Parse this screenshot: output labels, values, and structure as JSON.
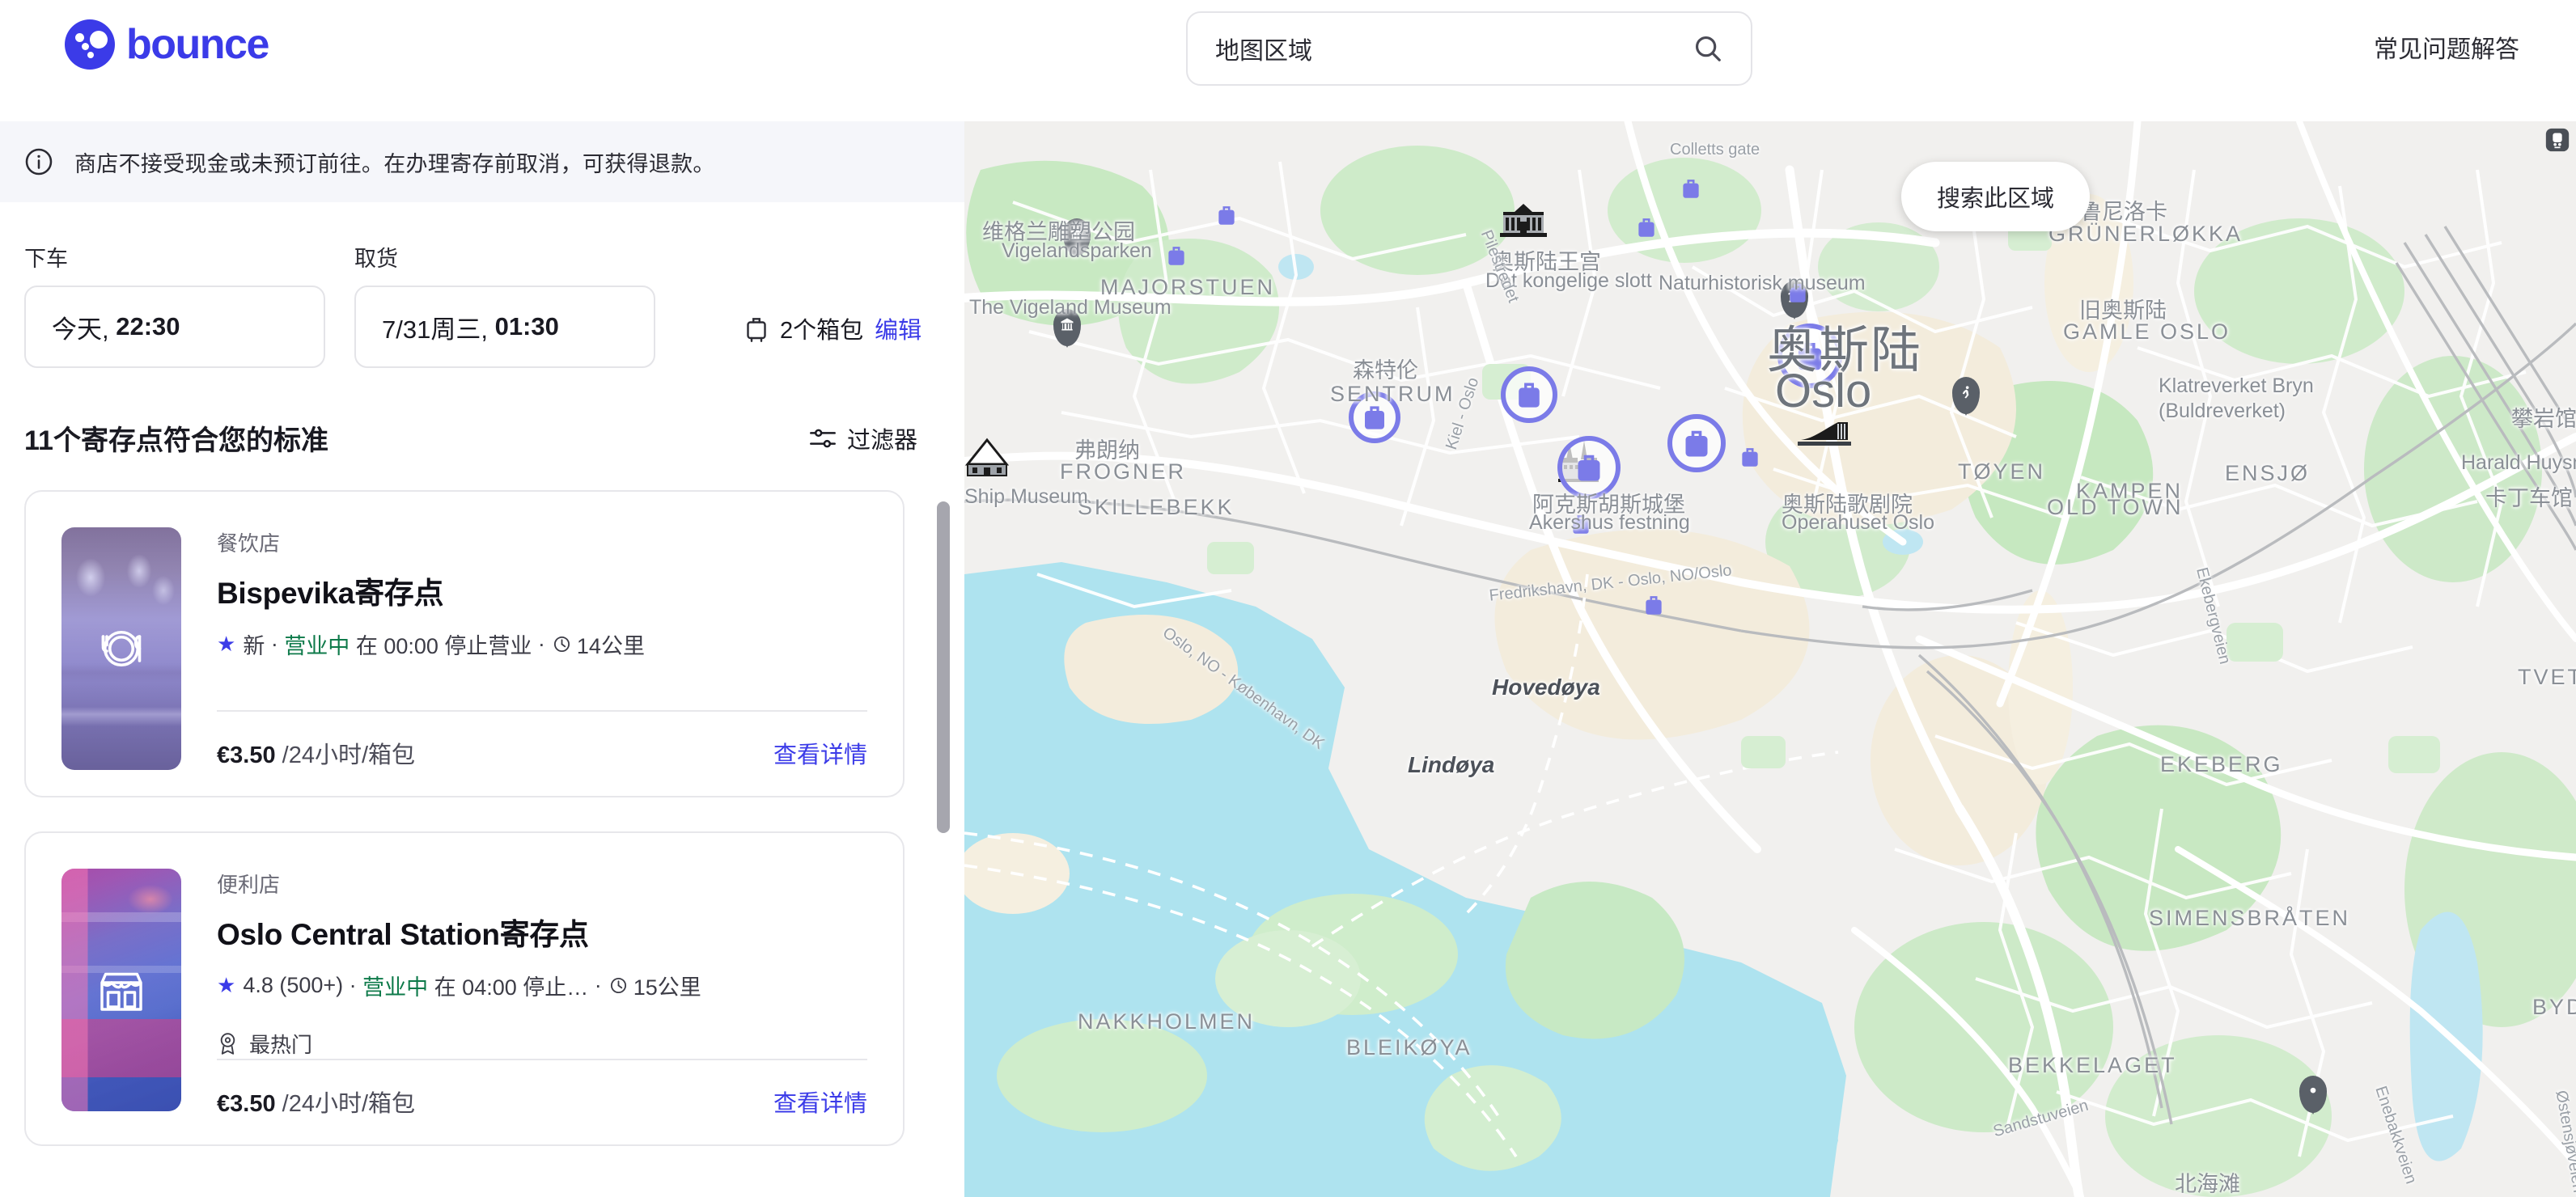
{
  "header": {
    "brand": "bounce",
    "search": {
      "value": "地图区域",
      "placeholder": "地图区域",
      "icon": "search-icon"
    },
    "faq_label": "常见问题解答"
  },
  "banner": {
    "icon": "info-icon",
    "text": "商店不接受现金或未预订前往。在办理寄存前取消，可获得退款。"
  },
  "booking": {
    "dropoff": {
      "label": "下车",
      "day": "今天,",
      "time": "22:30"
    },
    "pickup": {
      "label": "取货",
      "day": "7/31周三,",
      "time": "01:30"
    },
    "bags": {
      "icon": "luggage-icon",
      "count_label": "2个箱包",
      "edit_label": "编辑"
    }
  },
  "results": {
    "title": "11个寄存点符合您的标准",
    "filter": {
      "icon": "filter-icon",
      "label": "过滤器"
    },
    "cards": [
      {
        "thumb_class": "restaurant",
        "thumb_icon": "restaurant-icon",
        "category": "餐饮店",
        "title": "Bispevika寄存点",
        "rating": "新",
        "status": "营业中",
        "hours": "在 00:00 停止营业",
        "distance": "14公里",
        "badge": null,
        "price_amount": "€3.50",
        "price_unit": "/24小时/箱包",
        "details_label": "查看详情"
      },
      {
        "thumb_class": "convenience",
        "thumb_icon": "store-icon",
        "category": "便利店",
        "title": "Oslo Central Station寄存点",
        "rating": "4.8 (500+)",
        "status": "营业中",
        "hours": "在 04:00 停止…",
        "distance": "15公里",
        "badge": {
          "icon": "award-icon",
          "label": "最热门"
        },
        "price_amount": "€3.50",
        "price_unit": "/24小时/箱包",
        "details_label": "查看详情"
      }
    ]
  },
  "map": {
    "search_area_label": "搜索此区域",
    "corner_icon": "train-station-icon",
    "marker_color": "#7B7BE8",
    "city_label_cn": "奥斯陆",
    "city_label_en": "Oslo",
    "labels": [
      {
        "cn": "维格兰雕塑公园",
        "en": "Vigelandsparken"
      },
      {
        "cn": "",
        "en": "The Vigeland Museum"
      },
      {
        "cn": "",
        "en": "MAJORSTUEN"
      },
      {
        "cn": "弗朗纳",
        "en": "FROGNER"
      },
      {
        "cn": "",
        "en": "SKILLEBEKK"
      },
      {
        "cn": "奥斯陆王宫",
        "en": "Det kongelige slott"
      },
      {
        "cn": "森特伦",
        "en": "SENTRUM"
      },
      {
        "cn": "",
        "en": "Naturhistorisk museum"
      },
      {
        "cn": "葛鲁尼洛卡",
        "en": "GRÜNERLØKKA"
      },
      {
        "cn": "",
        "en": "TØYEN"
      },
      {
        "cn": "",
        "en": "KAMPEN"
      },
      {
        "cn": "",
        "en": "ENSJØ"
      },
      {
        "cn": "旧奥斯陆",
        "en": "GAMLE OSLO"
      },
      {
        "cn": "",
        "en": "OLD TOWN"
      },
      {
        "cn": "",
        "en": "EKEBERG"
      },
      {
        "cn": "",
        "en": "BEKKELAGET"
      },
      {
        "cn": "",
        "en": "NAKKHOLMEN"
      },
      {
        "cn": "",
        "en": "BLEIKØYA"
      },
      {
        "cn": "",
        "en": "SIMENSBRÅTEN"
      },
      {
        "cn": "",
        "en": "Klatreverket Bryn (Buldreverket)"
      },
      {
        "cn": "卡丁车馆",
        "en": "Harald Huysman Kart"
      },
      {
        "cn": "阿克斯胡斯城堡",
        "en": "Akershus festning"
      },
      {
        "cn": "奥斯陆歌剧院",
        "en": "Operahuset Oslo"
      },
      {
        "cn": "",
        "en": "Ship Museum"
      },
      {
        "cn": "",
        "en": "Hovedøya"
      },
      {
        "cn": "",
        "en": "Lindøya"
      },
      {
        "cn": "",
        "en": "Colletts gate"
      },
      {
        "cn": "",
        "en": "Pilestredet"
      },
      {
        "cn": "",
        "en": "Fredrikshavn, DK - Oslo, NO/Oslo"
      },
      {
        "cn": "",
        "en": "Kiel - Oslo"
      },
      {
        "cn": "",
        "en": "Oslo, NO - København, DK"
      },
      {
        "cn": "",
        "en": "Ekebergveien"
      },
      {
        "cn": "",
        "en": "Sandstuveien"
      },
      {
        "cn": "",
        "en": "Enebakkveien"
      },
      {
        "cn": "",
        "en": "Østensjøveien"
      },
      {
        "cn": "北海滩",
        "en": ""
      },
      {
        "cn": "",
        "en": "BYDE"
      },
      {
        "cn": "",
        "en": "Sandstuveien"
      },
      {
        "cn": "攀岩馆",
        "en": ""
      },
      {
        "cn": "",
        "en": "TVETENVEIEN"
      }
    ]
  }
}
